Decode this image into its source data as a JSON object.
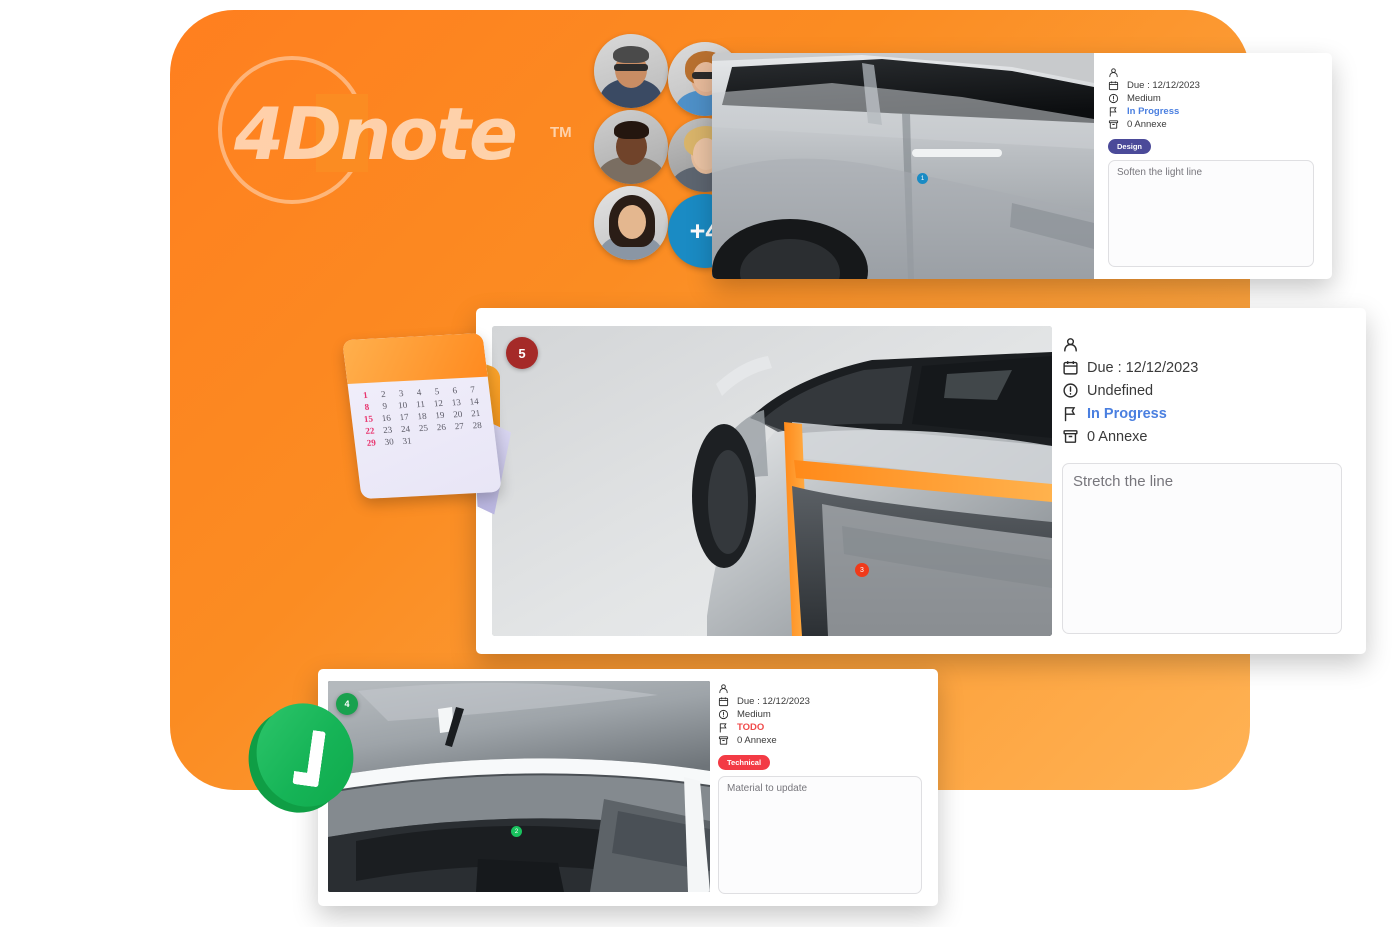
{
  "brand": {
    "logo_text": "4Dnote",
    "trademark": "TM",
    "accent_orange": "#fb8c22",
    "accent_blue": "#1a8bc4",
    "accent_green": "#16b457"
  },
  "team": {
    "overflow_label": "+4",
    "members": [
      {
        "name": "member-1"
      },
      {
        "name": "member-2"
      },
      {
        "name": "member-3"
      },
      {
        "name": "member-4"
      },
      {
        "name": "member-5"
      }
    ]
  },
  "calendar": {
    "days": [
      "1",
      "2",
      "3",
      "4",
      "5",
      "6",
      "7",
      "8",
      "9",
      "10",
      "11",
      "12",
      "13",
      "14",
      "15",
      "16",
      "17",
      "18",
      "19",
      "20",
      "21",
      "22",
      "23",
      "24",
      "25",
      "26",
      "27",
      "28",
      "29",
      "30",
      "31"
    ],
    "highlighted_days": [
      "1",
      "8",
      "15",
      "22",
      "29"
    ]
  },
  "icons": {
    "assignee": "person-icon",
    "due": "calendar-icon",
    "priority": "alert-circle-icon",
    "status": "flag-icon",
    "annexe": "archive-icon"
  },
  "cards": [
    {
      "id": "card-top",
      "image_name": "car-side-door-render",
      "marker": {
        "label": "1",
        "color": "#1a8bc4"
      },
      "assignee_label": "",
      "due": "Due : 12/12/2023",
      "priority": "Medium",
      "status": "In Progress",
      "status_color": "#4a7fe0",
      "annexe": "0 Annexe",
      "tag": {
        "label": "Design",
        "color": "#4b4a99"
      },
      "note": "Soften the light line"
    },
    {
      "id": "card-mid",
      "image_name": "car-rear-quarter-render",
      "badge": {
        "label": "5",
        "color": "#a52a28"
      },
      "marker": {
        "label": "3",
        "color": "#f03a1a"
      },
      "assignee_label": "",
      "due": "Due : 12/12/2023",
      "priority": "Undefined",
      "status": "In Progress",
      "status_color": "#4a7fe0",
      "annexe": "0 Annexe",
      "tag": null,
      "note": "Stretch the line"
    },
    {
      "id": "card-bot",
      "image_name": "car-front-grille-render",
      "badge": {
        "label": "4",
        "color": "#19a14e"
      },
      "marker": {
        "label": "2",
        "color": "#19c25e"
      },
      "assignee_label": "",
      "due": "Due : 12/12/2023",
      "priority": "Medium",
      "status": "TODO",
      "status_color": "#f04a4a",
      "annexe": "0 Annexe",
      "tag": {
        "label": "Technical",
        "color": "#f33b45"
      },
      "note": "Material to update"
    }
  ]
}
